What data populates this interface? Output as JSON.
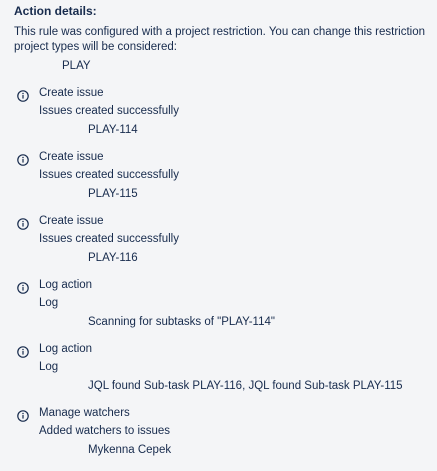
{
  "action_details": {
    "heading": "Action details:",
    "restriction_text_line1": "This rule was configured with a project restriction. You can change this restriction",
    "restriction_text_line2": "project types will be considered:",
    "project": "PLAY"
  },
  "entries": [
    {
      "icon": "info-icon",
      "title": "Create issue",
      "message": "Issues created successfully",
      "detail": "PLAY-114"
    },
    {
      "icon": "info-icon",
      "title": "Create issue",
      "message": "Issues created successfully",
      "detail": "PLAY-115"
    },
    {
      "icon": "info-icon",
      "title": "Create issue",
      "message": "Issues created successfully",
      "detail": "PLAY-116"
    },
    {
      "icon": "info-icon",
      "title": "Log action",
      "message": "Log",
      "detail": "Scanning for subtasks of \"PLAY-114\""
    },
    {
      "icon": "info-icon",
      "title": "Log action",
      "message": "Log",
      "detail": "JQL found Sub-task PLAY-116, JQL found Sub-task PLAY-115"
    },
    {
      "icon": "info-icon",
      "title": "Manage watchers",
      "message": "Added watchers to issues",
      "detail": "Mykenna Cepek"
    }
  ]
}
